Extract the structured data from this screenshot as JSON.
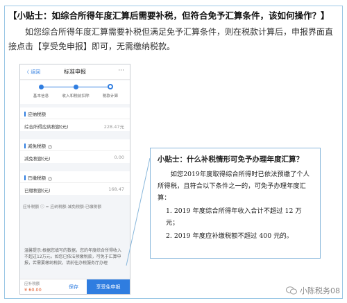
{
  "heading": "【小贴士：如综合所得年度汇算后需要补税，但符合免予汇算条件，该如何操作？】",
  "intro": "如您综合所得年度汇算需要补税但满足免予汇算条件，则在税款计算后，申报界面直接点击【享受免申报】即可，无需缴纳税款。",
  "phone": {
    "nav": {
      "back": "〈 返回",
      "title": "标准申报",
      "more": "···"
    },
    "steps": [
      "基本信息",
      "收入和税前扣除",
      "税款计算"
    ],
    "sections": [
      {
        "title": "应纳税额",
        "label": "综合所得应纳税额(元)",
        "value": "228.47元"
      },
      {
        "title": "减免税额",
        "label": "减免税额(元)",
        "value": "0.00"
      },
      {
        "title": "已缴税额",
        "label": "已缴税额(元)",
        "value": "168.47"
      }
    ],
    "formula": "应补税额 ⓘ = 应纳税额-减免税额-已缴税额",
    "tip": "温馨提示:根据您填写的数据，您的年度综合所得收入不超过12万元，如您已依法预缴税款，可免于汇算申报，若需要缴纳税款，请前往办税服务厅办理",
    "bottom": {
      "due_label": "应补税额",
      "due_value": "¥ 60.00",
      "save": "保存",
      "enjoy": "享受免申报"
    }
  },
  "callout": {
    "title": "小贴士：什么补税情形可免予办理年度汇算？",
    "body": "如您2019年度取得综合所得时已依法预缴了个人所得税，且符合以下条件之一的，可免予办理年度汇算：",
    "items": [
      "1. 2019 年度综合所得年收入合计不超过 12 万元；",
      "2. 2019 年度应补缴税额不超过 400 元的。"
    ]
  },
  "watermark": "小陈税务08",
  "colors": {
    "accent": "#2f7de0",
    "border": "#88b7db",
    "due": "#e05a2a"
  }
}
